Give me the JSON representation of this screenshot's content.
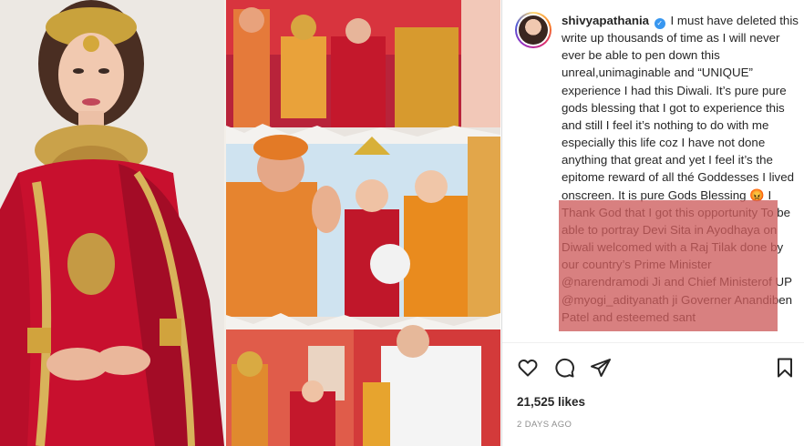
{
  "post": {
    "username": "shivyapathania",
    "caption_before": "I must have deleted this write up thousands of time as I will never ever be able to pen down this unreal,unimaginable and “UNIQUE” experience I had this Diwali. It’s pure pure gods blessing that I got to experience this and still I feel it’s nothing to do with me especially this life coz I have not done anything that great and yet I feel it’s the epitome reward of all thé Goddesses I lived onscreen. It is pure Gods Blessing 😡 I Thank God that I got this opportunity To be able to portray Devi Sita in Ayodhaya on Diwali welcomed with a Raj Tilak done by our country’s Prime Minister @narendramodi Ji and Chief Ministerof UP @myogi_adityanath ji Governer Anandiben Patel and esteemed sant",
    "likes": "21,525 likes",
    "date": "2 DAYS AGO"
  },
  "colors": {
    "highlight": "#cd5c5c",
    "verified": "#3897f0",
    "saree": "#c8102e"
  },
  "icons": [
    "heart-icon",
    "comment-icon",
    "share-icon",
    "bookmark-icon",
    "verified-icon"
  ]
}
